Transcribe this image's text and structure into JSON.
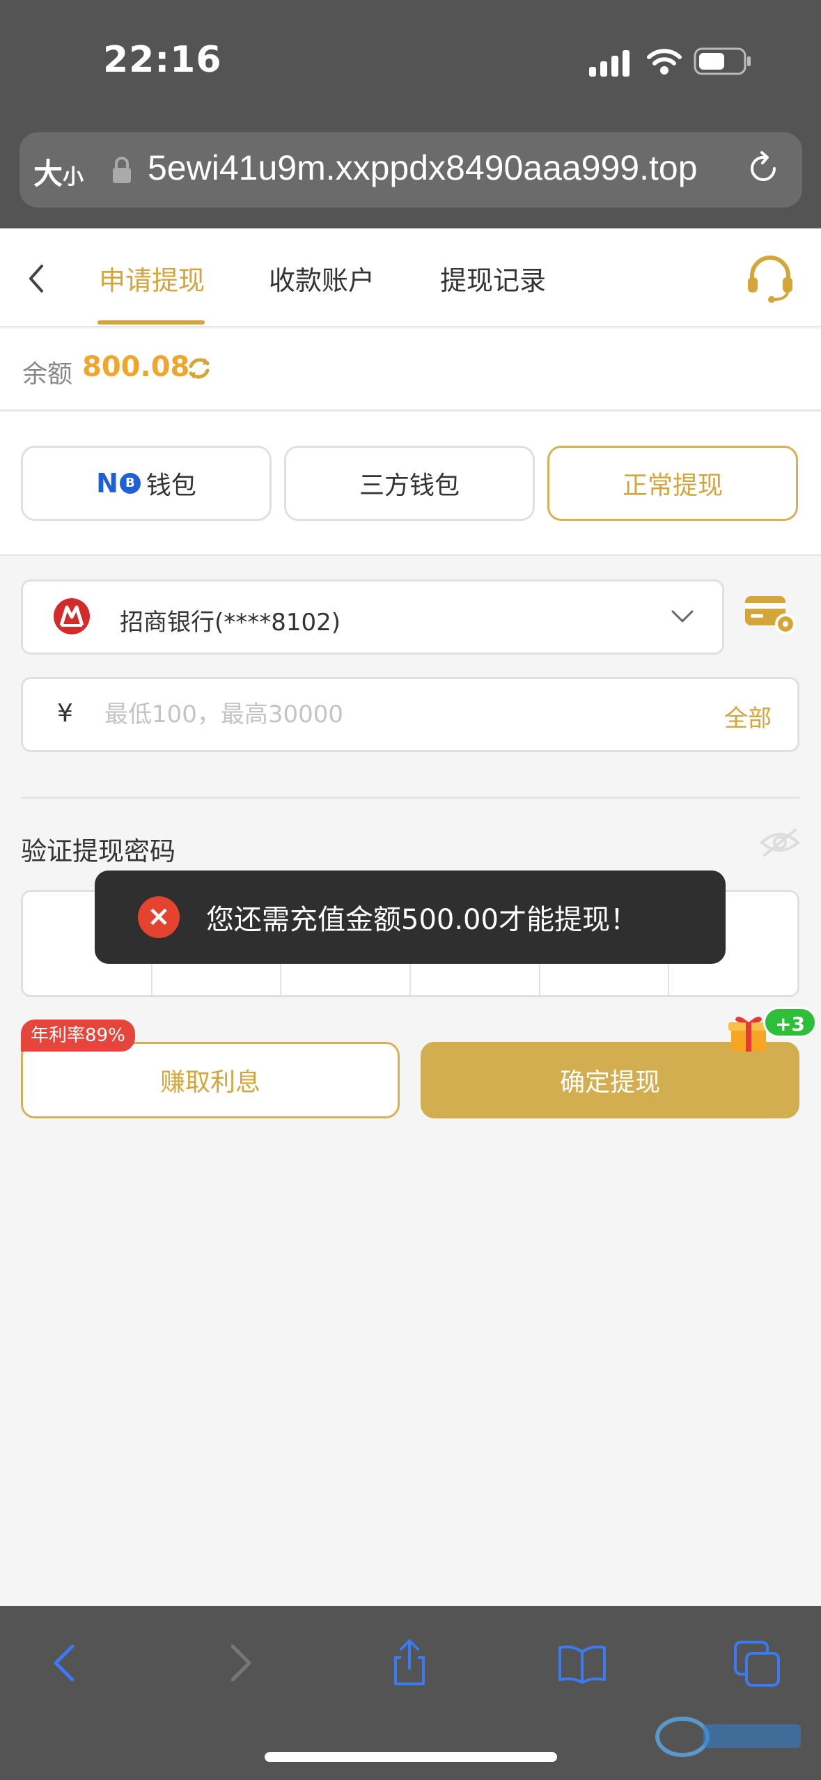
{
  "status_bar": {
    "time": "22:16"
  },
  "browser": {
    "text_size_label": "大",
    "text_size_small": "小",
    "url": "5ewi41u9m.xxppdx8490aaa999.top"
  },
  "header": {
    "tabs": [
      {
        "label": "申请提现",
        "active": true
      },
      {
        "label": "收款账户",
        "active": false
      },
      {
        "label": "提现记录",
        "active": false
      }
    ]
  },
  "balance": {
    "label": "余额",
    "value": "800.08"
  },
  "methods": [
    {
      "label": "钱包",
      "logo_text": "N",
      "logo_badge": "B"
    },
    {
      "label": "三方钱包"
    },
    {
      "label": "正常提现",
      "selected": true
    }
  ],
  "bank": {
    "name": "招商银行(****8102)"
  },
  "amount": {
    "currency": "¥",
    "placeholder": "最低100，最高30000",
    "value": "",
    "all_label": "全部"
  },
  "password": {
    "label": "验证提现密码",
    "cells": 6
  },
  "toast": {
    "icon": "error-x-icon",
    "text": "您还需充值金额500.00才能提现！"
  },
  "actions": {
    "rate_badge": "年利率89%",
    "earn_label": "赚取利息",
    "confirm_label": "确定提现",
    "gift_badge": "+3"
  },
  "colors": {
    "accent_gold": "#d4a63a",
    "balance_orange": "#f0a52c",
    "error_red": "#e4432f",
    "badge_green": "#2fbe3a",
    "safari_blue": "#3a7bf2"
  }
}
